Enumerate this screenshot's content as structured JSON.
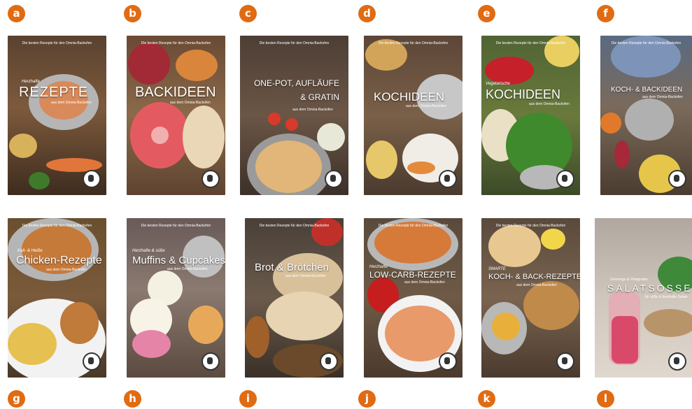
{
  "badges": [
    "a",
    "b",
    "c",
    "d",
    "e",
    "f",
    "g",
    "h",
    "i",
    "j",
    "k",
    "l"
  ],
  "covers": [
    {
      "head": "Die besten Rezepte für den Omnia-Backofen",
      "kicker": "Herzhafte",
      "title": "REZEPTE",
      "sub": "aus dem Omnia-Backofen"
    },
    {
      "head": "Die besten Rezepte für den Omnia-Backofen",
      "kicker": "",
      "title": "BACKIDEEN",
      "sub": "aus dem Omnia-Backofen"
    },
    {
      "head": "Die besten Rezepte für den Omnia-Backofen",
      "kicker": "",
      "title": "ONE-POT, AUFLÄUFE & GRATIN",
      "sub": "aus dem Omnia-Backofen"
    },
    {
      "head": "Die besten Rezepte für den Omnia-Backofen",
      "kicker": "",
      "title": "KOCHIDEEN",
      "sub": "aus dem Omnia-Backofen"
    },
    {
      "head": "Die besten Rezepte für den Omnia-Backofen",
      "kicker": "Vegetarische",
      "title": "KOCHIDEEN",
      "sub": "aus dem Omnia-Backofen"
    },
    {
      "head": "Die besten Rezepte für den Omnia-Backofen",
      "kicker": "",
      "title": "KOCH- & BACKIDEEN",
      "sub": "aus dem Omnia-Backofen"
    },
    {
      "head": "Die besten Rezepte für den Omnia-Backofen",
      "kicker": "Kalt- & Heiße",
      "title": "Chicken-Rezepte",
      "sub": "aus dem Omnia-Backofen"
    },
    {
      "head": "Die besten Rezepte für den Omnia-Backofen",
      "kicker": "Herzhafte & süße",
      "title": "Muffins & Cupcakes",
      "sub": "aus dem Omnia-Backofen"
    },
    {
      "head": "Die besten Rezepte für den Omnia-Backofen",
      "kicker": "",
      "title": "Brot & Brötchen",
      "sub": "aus dem Omnia-Backofen"
    },
    {
      "head": "Die besten Rezepte für den Omnia-Backofen",
      "kicker": "Herzhafte",
      "title": "LOW-CARB-REZEPTE",
      "sub": "aus dem Omnia-Backofen"
    },
    {
      "head": "Die besten Rezepte für den Omnia-Backofen",
      "kicker": "SMARTE",
      "title": "KOCH- & BACK-REZEPTE",
      "sub": "aus dem Omnia-Backofen"
    },
    {
      "head": "",
      "kicker": "Dressings & Vinaigrettes",
      "title": "SALATSOSSEN",
      "sub": "für süße & herzhafte Salate"
    }
  ]
}
